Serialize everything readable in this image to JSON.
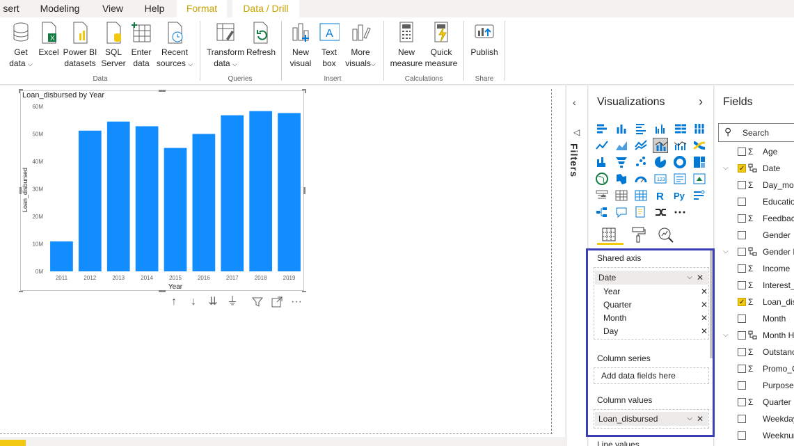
{
  "tabs": [
    {
      "label": "sert"
    },
    {
      "label": "Modeling"
    },
    {
      "label": "View"
    },
    {
      "label": "Help"
    },
    {
      "label": "Format"
    },
    {
      "label": "Data / Drill"
    }
  ],
  "ribbon": {
    "buttons": [
      {
        "label": "Get data",
        "l1": "Get",
        "l2": "data"
      },
      {
        "label": "Excel",
        "l1": "Excel",
        "l2": ""
      },
      {
        "label": "Power BI datasets",
        "l1": "Power BI",
        "l2": "datasets"
      },
      {
        "label": "SQL Server",
        "l1": "SQL",
        "l2": "Server"
      },
      {
        "label": "Enter data",
        "l1": "Enter",
        "l2": "data"
      },
      {
        "label": "Recent sources",
        "l1": "Recent",
        "l2": "sources"
      },
      {
        "label": "Transform data",
        "l1": "Transform",
        "l2": "data"
      },
      {
        "label": "Refresh",
        "l1": "Refresh",
        "l2": ""
      },
      {
        "label": "New visual",
        "l1": "New",
        "l2": "visual"
      },
      {
        "label": "Text box",
        "l1": "Text",
        "l2": "box"
      },
      {
        "label": "More visuals",
        "l1": "More",
        "l2": "visuals"
      },
      {
        "label": "New measure",
        "l1": "New",
        "l2": "measure"
      },
      {
        "label": "Quick measure",
        "l1": "Quick",
        "l2": "measure"
      },
      {
        "label": "Publish",
        "l1": "Publish",
        "l2": ""
      }
    ],
    "groups": [
      "Data",
      "Queries",
      "Insert",
      "Calculations",
      "Share"
    ]
  },
  "chart_data": {
    "type": "bar",
    "title": "Loan_disbursed by Year",
    "xlabel": "Year",
    "ylabel": "Loan_disbursed",
    "categories": [
      "2011",
      "2012",
      "2013",
      "2014",
      "2015",
      "2016",
      "2017",
      "2018",
      "2019"
    ],
    "values": [
      10.9,
      51.2,
      54.5,
      52.8,
      44.9,
      50.0,
      56.8,
      58.3,
      57.6
    ],
    "value_unit": "M",
    "ylim": [
      0,
      60
    ],
    "yticks": [
      "0M",
      "10M",
      "20M",
      "30M",
      "40M",
      "50M",
      "60M"
    ],
    "grid": false,
    "bar_color": "#118dff"
  },
  "filters": {
    "label": "Filters"
  },
  "visualizations": {
    "title": "Visualizations",
    "wells": {
      "shared_axis": {
        "label": "Shared axis",
        "field": "Date",
        "subfields": [
          "Year",
          "Quarter",
          "Month",
          "Day"
        ]
      },
      "column_series": {
        "label": "Column series",
        "placeholder": "Add data fields here"
      },
      "column_values": {
        "label": "Column values",
        "field": "Loan_disbursed"
      },
      "line_values": {
        "label": "Line values"
      }
    }
  },
  "fields": {
    "title": "Fields",
    "search_placeholder": "Search",
    "items": [
      {
        "name": "Age",
        "sigma": "Σ",
        "checked": false,
        "expander": ""
      },
      {
        "name": "Date",
        "sigma": "",
        "checked": true,
        "expander": "⌵"
      },
      {
        "name": "Day_mon",
        "sigma": "Σ",
        "checked": false,
        "expander": ""
      },
      {
        "name": "Educatio",
        "sigma": "",
        "checked": false,
        "expander": ""
      },
      {
        "name": "Feedbac",
        "sigma": "Σ",
        "checked": false,
        "expander": ""
      },
      {
        "name": "Gender",
        "sigma": "",
        "checked": false,
        "expander": ""
      },
      {
        "name": "Gender H",
        "sigma": "",
        "checked": false,
        "expander": "⌵"
      },
      {
        "name": "Income",
        "sigma": "Σ",
        "checked": false,
        "expander": ""
      },
      {
        "name": "Interest_",
        "sigma": "Σ",
        "checked": false,
        "expander": ""
      },
      {
        "name": "Loan_dis",
        "sigma": "Σ",
        "checked": true,
        "expander": ""
      },
      {
        "name": "Month",
        "sigma": "",
        "checked": false,
        "expander": ""
      },
      {
        "name": "Month H",
        "sigma": "",
        "checked": false,
        "expander": "⌵"
      },
      {
        "name": "Outstanc",
        "sigma": "Σ",
        "checked": false,
        "expander": ""
      },
      {
        "name": "Promo_C",
        "sigma": "Σ",
        "checked": false,
        "expander": ""
      },
      {
        "name": "Purpose",
        "sigma": "",
        "checked": false,
        "expander": ""
      },
      {
        "name": "Quarter",
        "sigma": "Σ",
        "checked": false,
        "expander": ""
      },
      {
        "name": "Weekday",
        "sigma": "",
        "checked": false,
        "expander": ""
      },
      {
        "name": "Weeknur",
        "sigma": "",
        "checked": false,
        "expander": ""
      }
    ]
  },
  "colors": {
    "accent": "#f2c811",
    "bar": "#118dff",
    "wells_border": "#3b3fb6"
  }
}
